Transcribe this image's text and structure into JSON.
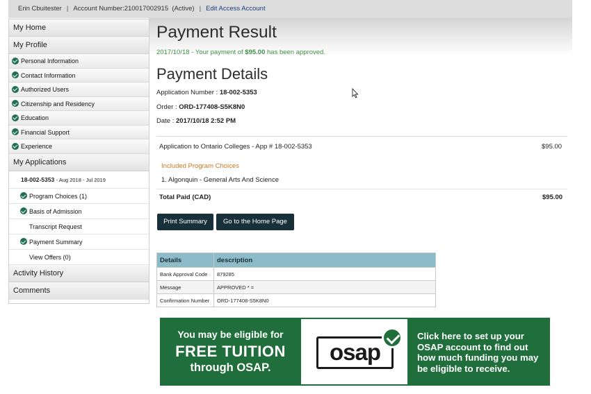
{
  "topbar": {
    "user_name": "Erin Cbuitester",
    "account": "Account Number:210017002915",
    "status": "(Active)",
    "edit_link": "Edit Access Account",
    "separator": "|"
  },
  "sidebar": {
    "my_home": "My Home",
    "my_profile": "My Profile",
    "profile_items": [
      {
        "label": "Personal Information"
      },
      {
        "label": "Contact Information"
      },
      {
        "label": "Authorized Users"
      },
      {
        "label": "Citizenship and Residency"
      },
      {
        "label": "Education"
      },
      {
        "label": "Financial Support"
      },
      {
        "label": "Experience"
      }
    ],
    "my_applications": "My Applications",
    "application": {
      "number": "18-002-5353",
      "range": "- Aug 2018 - Jul 2019"
    },
    "app_items": [
      {
        "label": "Program Choices (1)"
      },
      {
        "label": "Basis of Admission"
      },
      {
        "label": "Transcript Request"
      },
      {
        "label": "Payment Summary"
      },
      {
        "label": "View Offers (0)"
      }
    ],
    "activity_history": "Activity History",
    "comments": "Comments"
  },
  "main": {
    "payment_result_title": "Payment Result",
    "approval_prefix": "2017/10/18 - Your payment of ",
    "approval_amount": "$95.00",
    "approval_suffix": " has been approved.",
    "payment_details_title": "Payment Details",
    "application_number_label": "Application Number : ",
    "application_number_value": "18-002-5353",
    "order_label": "Order : ",
    "order_value": "ORD-177408-S5K8N0",
    "date_label": "Date : ",
    "date_value": "2017/10/18 2:52 PM",
    "line_item_label": "Application to Ontario Colleges - App # 18-002-5353",
    "line_item_amount": "$95.00",
    "included_heading": "Included Program Choices",
    "program_choice": "1. Algonquin - General Arts And Science",
    "total_label": "Total Paid (CAD)",
    "total_amount": "$95.00",
    "print_button": "Print Summary",
    "home_button": "Go to the Home Page"
  },
  "details_table": {
    "headers": [
      "Details",
      "description"
    ],
    "rows": [
      [
        "Bank Approval Code",
        "879285"
      ],
      [
        "Message",
        "APPROVED * ="
      ],
      [
        "Confirmation Number",
        "ORD-177408-S5K8N0"
      ]
    ]
  },
  "banner": {
    "line1": "You may be eligible for",
    "line2": "FREE TUITION",
    "line3": "through OSAP.",
    "logo_text": "osap",
    "cta": "Click here to set up your OSAP account to find out how much funding you may be eligible to receive.",
    "colors": {
      "background": "#1f6e3b",
      "text": "#ffffff"
    }
  },
  "icons": {
    "check": "check-circle-icon",
    "cursor": "mouse-pointer-icon"
  }
}
